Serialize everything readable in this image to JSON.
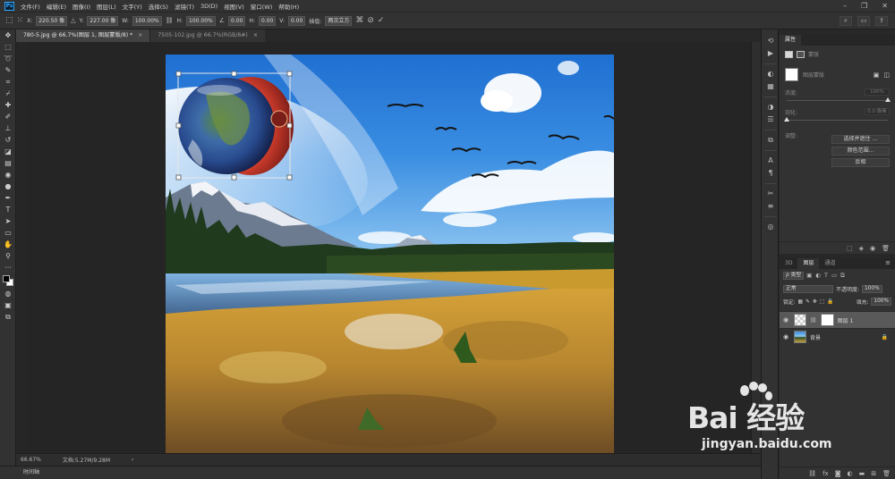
{
  "app": {
    "logo": "Ps"
  },
  "menu": [
    "文件(F)",
    "编辑(E)",
    "图像(I)",
    "图层(L)",
    "文字(Y)",
    "选择(S)",
    "滤镜(T)",
    "3D(D)",
    "视图(V)",
    "窗口(W)",
    "帮助(H)"
  ],
  "options": {
    "x_label": "X:",
    "x_value": "220.50 像",
    "y_label": "Y:",
    "y_value": "227.00 像",
    "w_label": "W:",
    "w_value": "100.00%",
    "h_label": "H:",
    "h_value": "100.00%",
    "angle_value": "0.00",
    "hskew_label": "H:",
    "hskew_value": "0.00",
    "vskew_label": "V:",
    "vskew_value": "0.00",
    "interp_label": "插值:",
    "interp_value": "两次立方"
  },
  "tabs": [
    {
      "label": "780-5.jpg @ 66.7%(图层 1, 图层蒙版/8) *",
      "active": true
    },
    {
      "label": "7505-102.jpg @ 66.7%(RGB/8#)",
      "active": false
    }
  ],
  "status": {
    "zoom": "66.67%",
    "doc": "文档:5.27M/9.28M"
  },
  "timeline": {
    "label": "时间轴"
  },
  "properties": {
    "tabs": [
      "属性"
    ],
    "subtitle": "蒙版",
    "layer_mask_label": "图层蒙版",
    "density_label": "浓度:",
    "density_value": "100%",
    "feather_label": "羽化:",
    "feather_value": "0.0 像素",
    "density_fraction": 1.0,
    "feather_fraction": 0.0,
    "refine_label": "调整:",
    "buttons": [
      "选择并遮住 ...",
      "颜色范围...",
      "反相"
    ]
  },
  "layers": {
    "tabs": [
      "3D",
      "图层",
      "通道"
    ],
    "active_tab": "图层",
    "filter_kind": "ρ 类型",
    "blend_mode": "正常",
    "opacity_label": "不透明度:",
    "opacity_value": "100%",
    "lock_label": "锁定:",
    "fill_label": "填充:",
    "fill_value": "100%",
    "rows": [
      {
        "name": "图层 1",
        "selected": true
      },
      {
        "name": "背景",
        "selected": false
      }
    ]
  },
  "watermark": {
    "main": "Bai 经验",
    "url": "jingyan.baidu.com"
  },
  "colors": {
    "sky": "#2f7fd8",
    "planet_red": "#c83a2a",
    "grass_gold": "#c99a2e"
  },
  "icons": [
    "move-icon",
    "marquee-icon",
    "lasso-icon",
    "quick-select-icon",
    "crop-icon",
    "eyedropper-icon",
    "brush-icon",
    "stamp-icon",
    "eraser-icon",
    "gradient-icon",
    "pen-icon",
    "type-icon",
    "path-select-icon",
    "shape-icon",
    "hand-icon",
    "zoom-icon"
  ]
}
